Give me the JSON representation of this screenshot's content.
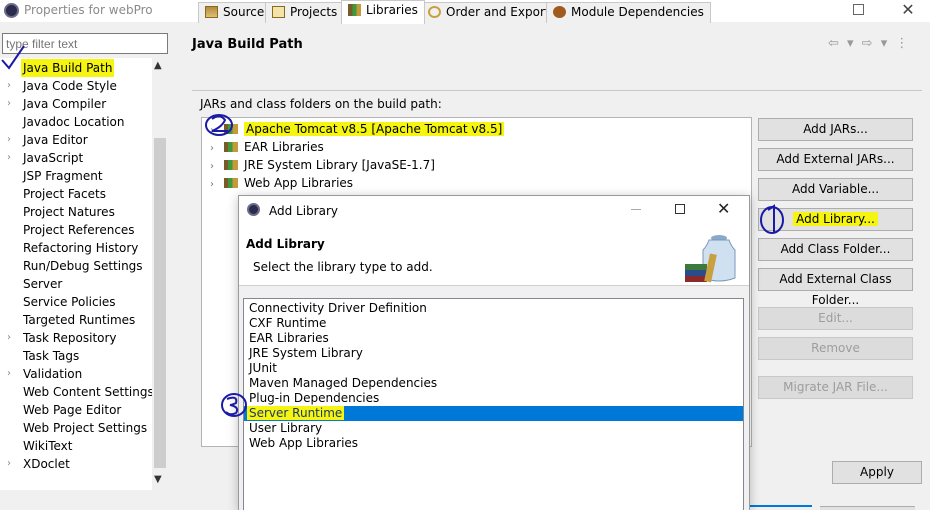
{
  "window": {
    "title": "Properties for webPro"
  },
  "filter": {
    "placeholder": "type filter text"
  },
  "nav": {
    "items": [
      {
        "label": "Java Build Path",
        "chev": ""
      },
      {
        "label": "Java Code Style",
        "chev": "›"
      },
      {
        "label": "Java Compiler",
        "chev": "›"
      },
      {
        "label": "Javadoc Location",
        "chev": ""
      },
      {
        "label": "Java Editor",
        "chev": "›"
      },
      {
        "label": "JavaScript",
        "chev": "›"
      },
      {
        "label": "JSP Fragment",
        "chev": ""
      },
      {
        "label": "Project Facets",
        "chev": ""
      },
      {
        "label": "Project Natures",
        "chev": ""
      },
      {
        "label": "Project References",
        "chev": ""
      },
      {
        "label": "Refactoring History",
        "chev": ""
      },
      {
        "label": "Run/Debug Settings",
        "chev": ""
      },
      {
        "label": "Server",
        "chev": ""
      },
      {
        "label": "Service Policies",
        "chev": ""
      },
      {
        "label": "Targeted Runtimes",
        "chev": ""
      },
      {
        "label": "Task Repository",
        "chev": "›"
      },
      {
        "label": "Task Tags",
        "chev": ""
      },
      {
        "label": "Validation",
        "chev": "›"
      },
      {
        "label": "Web Content Settings",
        "chev": ""
      },
      {
        "label": "Web Page Editor",
        "chev": ""
      },
      {
        "label": "Web Project Settings",
        "chev": ""
      },
      {
        "label": "WikiText",
        "chev": ""
      },
      {
        "label": "XDoclet",
        "chev": "›"
      }
    ]
  },
  "page": {
    "title": "Java Build Path",
    "tabs": [
      {
        "label": "Source",
        "icon": "source-icon"
      },
      {
        "label": "Projects",
        "icon": "projects-icon"
      },
      {
        "label": "Libraries",
        "icon": "libraries-icon"
      },
      {
        "label": "Order and Export",
        "icon": "order-export-icon"
      },
      {
        "label": "Module Dependencies",
        "icon": "module-deps-icon"
      }
    ],
    "jars_label": "JARs and class folders on the build path:",
    "tree": [
      {
        "label": "Apache Tomcat v8.5 [Apache Tomcat v8.5]"
      },
      {
        "label": "EAR Libraries"
      },
      {
        "label": "JRE System Library [JavaSE-1.7]"
      },
      {
        "label": "Web App Libraries"
      }
    ],
    "buttons": [
      {
        "label": "Add JARs..."
      },
      {
        "label": "Add External JARs..."
      },
      {
        "label": "Add Variable..."
      },
      {
        "label": "Add Library..."
      },
      {
        "label": "Add Class Folder..."
      },
      {
        "label": "Add External Class Folder..."
      },
      {
        "label": "Edit..."
      },
      {
        "label": "Remove"
      },
      {
        "label": "Migrate JAR File..."
      }
    ],
    "apply": "Apply"
  },
  "dialog": {
    "title": "Add Library",
    "heading": "Add Library",
    "subtitle": "Select the library type to add.",
    "items": [
      "Connectivity Driver Definition",
      "CXF Runtime",
      "EAR Libraries",
      "JRE System Library",
      "JUnit",
      "Maven Managed Dependencies",
      "Plug-in Dependencies",
      "Server Runtime",
      "User Library",
      "Web App Libraries"
    ],
    "selected": "Server Runtime"
  },
  "colors": {
    "highlight": "#f5f511",
    "selection": "#0078d7",
    "annotation_ink": "#1a1aa8"
  }
}
